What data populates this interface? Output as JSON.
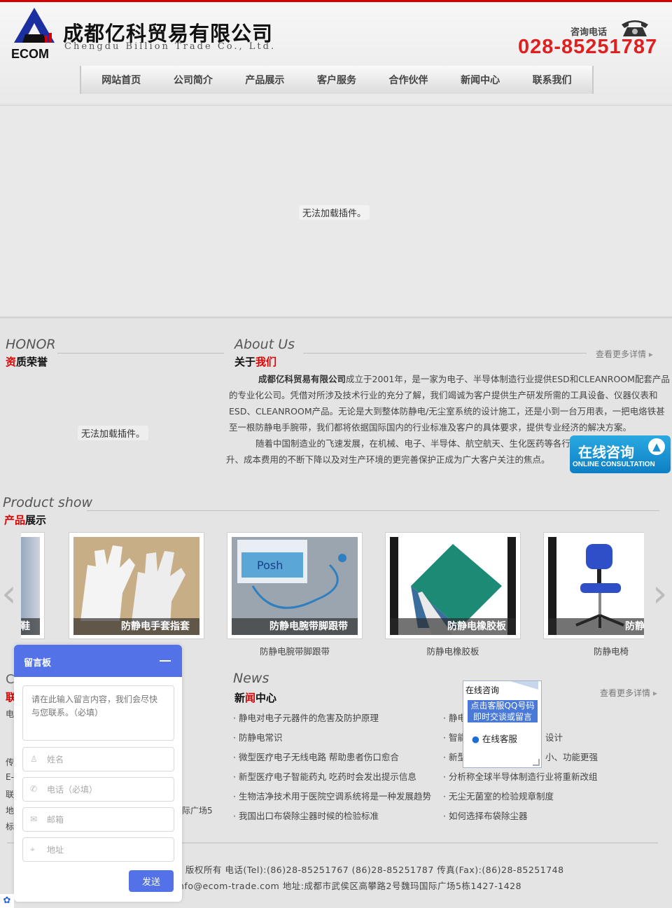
{
  "brand": {
    "logo_text": "ECOM",
    "company_cn": "成都亿科贸易有限公司",
    "company_en": "Chengdu Billion Trade Co., Ltd.",
    "hotline_label": "咨询电话",
    "hotline": "028-85251787"
  },
  "nav": [
    "网站首页",
    "公司简介",
    "产品展示",
    "客户服务",
    "合作伙伴",
    "新闻中心",
    "联系我们"
  ],
  "plugin_error": "无法加载插件。",
  "honor": {
    "en": "HONOR",
    "cn_hl": "资",
    "cn_rest": "质荣誉"
  },
  "about": {
    "en": "About Us",
    "cn_a": "关于",
    "cn_hl": "我们",
    "more": "查看更多详情",
    "company_bold": "成都亿科贸易有限公司",
    "p1": "成立于2001年，是一家为电子、半导体制造行业提供ESD和CLEANROOM配套产品的专业化公司。凭借对所涉及技术行业的充分了解，我们竭诚为客户提供生产研发所需的工具设备、仪器仪表和ESD、CLEANROOM产品。无论是大到整体防静电/无尘室系统的设计施工，还是小到一台万用表，一把电烙铁甚至一根防静电手腕带，我们都将依据国际国内的行业标准及客户的具体要求，提供专业经济的解决方案。",
    "p2": "随着中国制造业的飞速发展，在机械、电子、半导体、航空航天、生化医药等各行业对产品质量的不断提升、成本费用的不断下降以及对生产环境的更完善保护正成为广大客户关注的焦点。"
  },
  "products": {
    "en": "Product show",
    "cn_hl": "产品",
    "cn_rest": "展示",
    "items": [
      {
        "caption": "防静电鞋",
        "name": ""
      },
      {
        "caption": "防静电手套指套",
        "name": ""
      },
      {
        "caption": "防静电腕带脚跟带",
        "name": "防静电腕带脚跟带"
      },
      {
        "caption": "防静电橡胶板",
        "name": "防静电橡胶板"
      },
      {
        "caption": "防静电椅",
        "name": "防静电椅"
      }
    ]
  },
  "news": {
    "en": "News",
    "cn_a": "新",
    "cn_hl": "闻",
    "cn_rest": "中心",
    "more": "查看更多详情",
    "left": [
      "静电对电子元器件的危害及防护原理",
      "防静电常识",
      "微型医疗电子无线电路 帮助患者伤口愈合",
      "新型医疗电子智能药丸 吃药时会发出提示信息",
      "生物洁净技术用于医院空调系统将是一种发展趋势",
      "我国出口布袋除尘器时候的检验标准"
    ],
    "right": [
      "静电",
      "智能",
      "新型",
      "分析称全球半导体制造行业将重新改组",
      "无尘无菌室的检验规章制度",
      "如何选择布袋除尘器"
    ],
    "right_tail": [
      "设计",
      "小、功能更强"
    ]
  },
  "contact_fragments": {
    "heading_letter": "联",
    "items": [
      "电",
      "传",
      "E-",
      "联",
      "地",
      "标"
    ],
    "addr_tail": "际广场5"
  },
  "footer": {
    "line1": ") 版权所有 电话(Tel):(86)28-85251767 (86)28-85251787 传真(Fax):(86)28-85251748",
    "line2": "nfo@ecom-trade.com 地址:成都市武侯区高攀路2号魏玛国际广场5栋1427-1428"
  },
  "consult_float": {
    "title": "在线咨询",
    "subtitle": "ONLINE CONSULTATION"
  },
  "qq_box": {
    "title": "在线咨询",
    "button_line1": "点击客服QQ号码",
    "button_line2": "即时交谈或留言",
    "service": "在线客服"
  },
  "message_board": {
    "title": "留言板",
    "content_placeholder": "请在此输入留言内容，我们会尽快与您联系。（必填）",
    "name_placeholder": "姓名",
    "phone_placeholder": "电话（必填）",
    "email_placeholder": "邮箱",
    "address_placeholder": "地址",
    "send_label": "发送"
  },
  "colors": {
    "accent_red": "#e00000",
    "hotline_red": "#e02020",
    "board_blue": "#5372e8",
    "float_blue": "#1b8fd0"
  },
  "icons": [
    "phone-icon",
    "arrow-left-icon",
    "arrow-right-icon",
    "qq-icon",
    "user-icon",
    "phone-icon",
    "mail-icon",
    "location-icon",
    "minimize-icon",
    "paw-icon"
  ]
}
